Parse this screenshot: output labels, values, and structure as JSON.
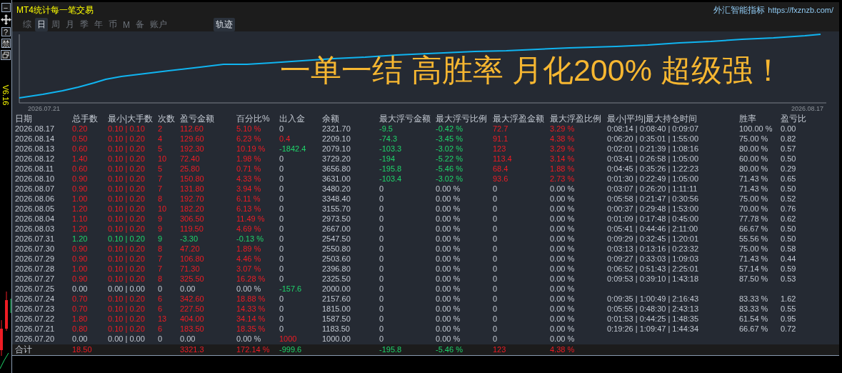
{
  "title": "MT4统计每一笔交易",
  "brand": {
    "name": "外汇智能指标",
    "url": "https://fxznzb.com/"
  },
  "side_buttons": [
    "−",
    "?",
    "禁"
  ],
  "version": "V6.16",
  "tabs": [
    {
      "label": "综",
      "selected": false
    },
    {
      "label": "日",
      "selected": true
    },
    {
      "label": "周",
      "selected": false
    },
    {
      "label": "月",
      "selected": false
    },
    {
      "label": "季",
      "selected": false
    },
    {
      "label": "年",
      "selected": false
    },
    {
      "label": "币",
      "selected": false
    },
    {
      "label": "M",
      "selected": false
    },
    {
      "label": "备",
      "selected": false
    },
    {
      "label": "账户",
      "selected": false
    },
    {
      "label": "轨迹",
      "selected": true
    }
  ],
  "chart": {
    "start_date": "2026.07.21",
    "end_date": "2026.08.17",
    "slogan": "一单一结 高胜率 月化200% 超级强！"
  },
  "table": {
    "columns": [
      "日期",
      "总手数",
      "最小|大手数",
      "次数",
      "盈亏金额",
      "百分比%",
      "出入金",
      "余额",
      "最大浮亏金额",
      "最大浮亏比例",
      "最大浮盈金额",
      "最大浮盈比例",
      "最小|平均|最大持仓时间",
      "胜率",
      "盈亏比"
    ],
    "rows": [
      {
        "cells": [
          {
            "text": "2026.08.17",
            "kind": "plain"
          },
          {
            "text": "0.20",
            "kind": "profit"
          },
          {
            "text": "0.10 | 0.10",
            "kind": "profit"
          },
          {
            "text": "2",
            "kind": "profit"
          },
          {
            "text": "112.60",
            "kind": "profit"
          },
          {
            "text": "5.10 %",
            "kind": "profit"
          },
          {
            "text": "0",
            "kind": "plain"
          },
          {
            "text": "2321.70",
            "kind": "plain"
          },
          {
            "text": "-9.5",
            "kind": "loss"
          },
          {
            "text": "-0.42 %",
            "kind": "loss"
          },
          {
            "text": "72.7",
            "kind": "profit"
          },
          {
            "text": "3.29 %",
            "kind": "profit"
          },
          {
            "text": "0:08:14 | 0:08:40 | 0:09:07",
            "kind": "plain"
          },
          {
            "text": "100.00 %",
            "kind": "plain"
          },
          {
            "text": "0.00",
            "kind": "plain"
          }
        ]
      },
      {
        "cells": [
          {
            "text": "2026.08.14",
            "kind": "plain"
          },
          {
            "text": "0.50",
            "kind": "profit"
          },
          {
            "text": "0.10 | 0.20",
            "kind": "profit"
          },
          {
            "text": "4",
            "kind": "profit"
          },
          {
            "text": "129.60",
            "kind": "profit"
          },
          {
            "text": "6.23 %",
            "kind": "profit"
          },
          {
            "text": "0.4",
            "kind": "profit"
          },
          {
            "text": "2209.10",
            "kind": "plain"
          },
          {
            "text": "-74.3",
            "kind": "loss"
          },
          {
            "text": "-3.45 %",
            "kind": "loss"
          },
          {
            "text": "91.1",
            "kind": "profit"
          },
          {
            "text": "4.38 %",
            "kind": "profit"
          },
          {
            "text": "0:06:20 | 0:35:01 | 1:55:00",
            "kind": "plain"
          },
          {
            "text": "75.00 %",
            "kind": "plain"
          },
          {
            "text": "0.82",
            "kind": "plain"
          }
        ]
      },
      {
        "cells": [
          {
            "text": "2026.08.13",
            "kind": "plain"
          },
          {
            "text": "0.60",
            "kind": "profit"
          },
          {
            "text": "0.10 | 0.20",
            "kind": "profit"
          },
          {
            "text": "5",
            "kind": "profit"
          },
          {
            "text": "192.30",
            "kind": "profit"
          },
          {
            "text": "10.19 %",
            "kind": "profit"
          },
          {
            "text": "-1842.4",
            "kind": "loss"
          },
          {
            "text": "2079.10",
            "kind": "plain"
          },
          {
            "text": "-103.3",
            "kind": "loss"
          },
          {
            "text": "-3.02 %",
            "kind": "loss"
          },
          {
            "text": "123",
            "kind": "profit"
          },
          {
            "text": "3.29 %",
            "kind": "profit"
          },
          {
            "text": "0:02:01 | 0:21:39 | 1:08:16",
            "kind": "plain"
          },
          {
            "text": "80.00 %",
            "kind": "plain"
          },
          {
            "text": "0.57",
            "kind": "plain"
          }
        ]
      },
      {
        "cells": [
          {
            "text": "2026.08.12",
            "kind": "plain"
          },
          {
            "text": "1.40",
            "kind": "profit"
          },
          {
            "text": "0.10 | 0.20",
            "kind": "profit"
          },
          {
            "text": "10",
            "kind": "profit"
          },
          {
            "text": "72.40",
            "kind": "profit"
          },
          {
            "text": "1.98 %",
            "kind": "profit"
          },
          {
            "text": "0",
            "kind": "plain"
          },
          {
            "text": "3729.20",
            "kind": "plain"
          },
          {
            "text": "-194",
            "kind": "loss"
          },
          {
            "text": "-5.22 %",
            "kind": "loss"
          },
          {
            "text": "113.4",
            "kind": "profit"
          },
          {
            "text": "3.14 %",
            "kind": "profit"
          },
          {
            "text": "0:03:41 | 0:26:58 | 1:05:00",
            "kind": "plain"
          },
          {
            "text": "60.00 %",
            "kind": "plain"
          },
          {
            "text": "0.50",
            "kind": "plain"
          }
        ]
      },
      {
        "cells": [
          {
            "text": "2026.08.11",
            "kind": "plain"
          },
          {
            "text": "0.60",
            "kind": "profit"
          },
          {
            "text": "0.10 | 0.20",
            "kind": "profit"
          },
          {
            "text": "5",
            "kind": "profit"
          },
          {
            "text": "25.80",
            "kind": "profit"
          },
          {
            "text": "0.71 %",
            "kind": "profit"
          },
          {
            "text": "0",
            "kind": "plain"
          },
          {
            "text": "3656.80",
            "kind": "plain"
          },
          {
            "text": "-195.8",
            "kind": "loss"
          },
          {
            "text": "-5.46 %",
            "kind": "loss"
          },
          {
            "text": "68.4",
            "kind": "profit"
          },
          {
            "text": "1.88 %",
            "kind": "profit"
          },
          {
            "text": "0:04:45 | 0:35:26 | 1:22:23",
            "kind": "plain"
          },
          {
            "text": "80.00 %",
            "kind": "plain"
          },
          {
            "text": "0.29",
            "kind": "plain"
          }
        ]
      },
      {
        "cells": [
          {
            "text": "2026.08.10",
            "kind": "plain"
          },
          {
            "text": "0.90",
            "kind": "profit"
          },
          {
            "text": "0.10 | 0.20",
            "kind": "profit"
          },
          {
            "text": "7",
            "kind": "profit"
          },
          {
            "text": "150.80",
            "kind": "profit"
          },
          {
            "text": "4.33 %",
            "kind": "profit"
          },
          {
            "text": "0",
            "kind": "plain"
          },
          {
            "text": "3631.00",
            "kind": "plain"
          },
          {
            "text": "-103.4",
            "kind": "loss"
          },
          {
            "text": "-3.02 %",
            "kind": "loss"
          },
          {
            "text": "93.6",
            "kind": "profit"
          },
          {
            "text": "2.73 %",
            "kind": "profit"
          },
          {
            "text": "0:01:30 | 0:22:49 | 1:05:00",
            "kind": "plain"
          },
          {
            "text": "71.43 %",
            "kind": "plain"
          },
          {
            "text": "0.65",
            "kind": "plain"
          }
        ]
      },
      {
        "cells": [
          {
            "text": "2026.08.07",
            "kind": "plain"
          },
          {
            "text": "0.90",
            "kind": "profit"
          },
          {
            "text": "0.10 | 0.20",
            "kind": "profit"
          },
          {
            "text": "7",
            "kind": "profit"
          },
          {
            "text": "131.80",
            "kind": "profit"
          },
          {
            "text": "3.94 %",
            "kind": "profit"
          },
          {
            "text": "0",
            "kind": "plain"
          },
          {
            "text": "3480.20",
            "kind": "plain"
          },
          {
            "text": "0",
            "kind": "plain"
          },
          {
            "text": "0.00 %",
            "kind": "plain"
          },
          {
            "text": "0",
            "kind": "plain"
          },
          {
            "text": "0.00 %",
            "kind": "plain"
          },
          {
            "text": "0:03:07 | 0:26:20 | 1:11:11",
            "kind": "plain"
          },
          {
            "text": "71.43 %",
            "kind": "plain"
          },
          {
            "text": "0.50",
            "kind": "plain"
          }
        ]
      },
      {
        "cells": [
          {
            "text": "2026.08.06",
            "kind": "plain"
          },
          {
            "text": "1.00",
            "kind": "profit"
          },
          {
            "text": "0.10 | 0.20",
            "kind": "profit"
          },
          {
            "text": "8",
            "kind": "profit"
          },
          {
            "text": "192.70",
            "kind": "profit"
          },
          {
            "text": "6.11 %",
            "kind": "profit"
          },
          {
            "text": "0",
            "kind": "plain"
          },
          {
            "text": "3348.40",
            "kind": "plain"
          },
          {
            "text": "0",
            "kind": "plain"
          },
          {
            "text": "0.00 %",
            "kind": "plain"
          },
          {
            "text": "0",
            "kind": "plain"
          },
          {
            "text": "0.00 %",
            "kind": "plain"
          },
          {
            "text": "0:05:58 | 0:21:47 | 0:30:56",
            "kind": "plain"
          },
          {
            "text": "75.00 %",
            "kind": "plain"
          },
          {
            "text": "0.52",
            "kind": "plain"
          }
        ]
      },
      {
        "cells": [
          {
            "text": "2026.08.05",
            "kind": "plain"
          },
          {
            "text": "1.20",
            "kind": "profit"
          },
          {
            "text": "0.10 | 0.20",
            "kind": "profit"
          },
          {
            "text": "10",
            "kind": "profit"
          },
          {
            "text": "182.20",
            "kind": "profit"
          },
          {
            "text": "6.13 %",
            "kind": "profit"
          },
          {
            "text": "0",
            "kind": "plain"
          },
          {
            "text": "3155.70",
            "kind": "plain"
          },
          {
            "text": "0",
            "kind": "plain"
          },
          {
            "text": "0.00 %",
            "kind": "plain"
          },
          {
            "text": "0",
            "kind": "plain"
          },
          {
            "text": "0.00 %",
            "kind": "plain"
          },
          {
            "text": "0:00:37 | 0:29:48 | 1:53:00",
            "kind": "plain"
          },
          {
            "text": "70.00 %",
            "kind": "plain"
          },
          {
            "text": "0.76",
            "kind": "plain"
          }
        ]
      },
      {
        "cells": [
          {
            "text": "2026.08.04",
            "kind": "plain"
          },
          {
            "text": "1.10",
            "kind": "profit"
          },
          {
            "text": "0.10 | 0.20",
            "kind": "profit"
          },
          {
            "text": "9",
            "kind": "profit"
          },
          {
            "text": "306.50",
            "kind": "profit"
          },
          {
            "text": "11.49 %",
            "kind": "profit"
          },
          {
            "text": "0",
            "kind": "plain"
          },
          {
            "text": "2973.50",
            "kind": "plain"
          },
          {
            "text": "0",
            "kind": "plain"
          },
          {
            "text": "0.00 %",
            "kind": "plain"
          },
          {
            "text": "0",
            "kind": "plain"
          },
          {
            "text": "0.00 %",
            "kind": "plain"
          },
          {
            "text": "0:01:09 | 0:17:48 | 0:45:00",
            "kind": "plain"
          },
          {
            "text": "77.78 %",
            "kind": "plain"
          },
          {
            "text": "0.62",
            "kind": "plain"
          }
        ]
      },
      {
        "cells": [
          {
            "text": "2026.08.03",
            "kind": "plain"
          },
          {
            "text": "1.20",
            "kind": "profit"
          },
          {
            "text": "0.10 | 0.20",
            "kind": "profit"
          },
          {
            "text": "9",
            "kind": "profit"
          },
          {
            "text": "119.50",
            "kind": "profit"
          },
          {
            "text": "4.69 %",
            "kind": "profit"
          },
          {
            "text": "0",
            "kind": "plain"
          },
          {
            "text": "2667.00",
            "kind": "plain"
          },
          {
            "text": "0",
            "kind": "plain"
          },
          {
            "text": "0.00 %",
            "kind": "plain"
          },
          {
            "text": "0",
            "kind": "plain"
          },
          {
            "text": "0.00 %",
            "kind": "plain"
          },
          {
            "text": "0:05:41 | 0:44:46 | 2:11:00",
            "kind": "plain"
          },
          {
            "text": "66.67 %",
            "kind": "plain"
          },
          {
            "text": "0.50",
            "kind": "plain"
          }
        ]
      },
      {
        "cells": [
          {
            "text": "2026.07.31",
            "kind": "plain"
          },
          {
            "text": "1.20",
            "kind": "loss"
          },
          {
            "text": "0.10 | 0.20",
            "kind": "loss"
          },
          {
            "text": "9",
            "kind": "loss"
          },
          {
            "text": "-3.30",
            "kind": "loss"
          },
          {
            "text": "-0.13 %",
            "kind": "loss"
          },
          {
            "text": "0",
            "kind": "plain"
          },
          {
            "text": "2547.50",
            "kind": "plain"
          },
          {
            "text": "0",
            "kind": "plain"
          },
          {
            "text": "0.00 %",
            "kind": "plain"
          },
          {
            "text": "0",
            "kind": "plain"
          },
          {
            "text": "0.00 %",
            "kind": "plain"
          },
          {
            "text": "0:09:29 | 0:32:45 | 1:20:01",
            "kind": "plain"
          },
          {
            "text": "55.56 %",
            "kind": "plain"
          },
          {
            "text": "0.50",
            "kind": "plain"
          }
        ]
      },
      {
        "cells": [
          {
            "text": "2026.07.30",
            "kind": "plain"
          },
          {
            "text": "0.90",
            "kind": "profit"
          },
          {
            "text": "0.10 | 0.20",
            "kind": "profit"
          },
          {
            "text": "8",
            "kind": "profit"
          },
          {
            "text": "47.20",
            "kind": "profit"
          },
          {
            "text": "1.89 %",
            "kind": "profit"
          },
          {
            "text": "0",
            "kind": "plain"
          },
          {
            "text": "2550.80",
            "kind": "plain"
          },
          {
            "text": "0",
            "kind": "plain"
          },
          {
            "text": "0.00 %",
            "kind": "plain"
          },
          {
            "text": "0",
            "kind": "plain"
          },
          {
            "text": "0.00 %",
            "kind": "plain"
          },
          {
            "text": "0:03:13 | 0:13:16 | 0:23:32",
            "kind": "plain"
          },
          {
            "text": "75.00 %",
            "kind": "plain"
          },
          {
            "text": "0.58",
            "kind": "plain"
          }
        ]
      },
      {
        "cells": [
          {
            "text": "2026.07.29",
            "kind": "plain"
          },
          {
            "text": "0.90",
            "kind": "profit"
          },
          {
            "text": "0.10 | 0.20",
            "kind": "profit"
          },
          {
            "text": "7",
            "kind": "profit"
          },
          {
            "text": "106.80",
            "kind": "profit"
          },
          {
            "text": "4.46 %",
            "kind": "profit"
          },
          {
            "text": "0",
            "kind": "plain"
          },
          {
            "text": "2503.60",
            "kind": "plain"
          },
          {
            "text": "0",
            "kind": "plain"
          },
          {
            "text": "0.00 %",
            "kind": "plain"
          },
          {
            "text": "0",
            "kind": "plain"
          },
          {
            "text": "0.00 %",
            "kind": "plain"
          },
          {
            "text": "0:09:27 | 0:33:03 | 1:09:03",
            "kind": "plain"
          },
          {
            "text": "71.43 %",
            "kind": "plain"
          },
          {
            "text": "0.44",
            "kind": "plain"
          }
        ]
      },
      {
        "cells": [
          {
            "text": "2026.07.28",
            "kind": "plain"
          },
          {
            "text": "1.00",
            "kind": "profit"
          },
          {
            "text": "0.10 | 0.20",
            "kind": "profit"
          },
          {
            "text": "7",
            "kind": "profit"
          },
          {
            "text": "71.30",
            "kind": "profit"
          },
          {
            "text": "3.07 %",
            "kind": "profit"
          },
          {
            "text": "0",
            "kind": "plain"
          },
          {
            "text": "2396.80",
            "kind": "plain"
          },
          {
            "text": "0",
            "kind": "plain"
          },
          {
            "text": "0.00 %",
            "kind": "plain"
          },
          {
            "text": "0",
            "kind": "plain"
          },
          {
            "text": "0.00 %",
            "kind": "plain"
          },
          {
            "text": "0:06:52 | 0:51:43 | 2:25:01",
            "kind": "plain"
          },
          {
            "text": "57.14 %",
            "kind": "plain"
          },
          {
            "text": "0.59",
            "kind": "plain"
          }
        ]
      },
      {
        "cells": [
          {
            "text": "2026.07.27",
            "kind": "plain"
          },
          {
            "text": "0.90",
            "kind": "profit"
          },
          {
            "text": "0.10 | 0.20",
            "kind": "profit"
          },
          {
            "text": "8",
            "kind": "profit"
          },
          {
            "text": "325.50",
            "kind": "profit"
          },
          {
            "text": "16.28 %",
            "kind": "profit"
          },
          {
            "text": "0",
            "kind": "plain"
          },
          {
            "text": "2325.50",
            "kind": "plain"
          },
          {
            "text": "0",
            "kind": "plain"
          },
          {
            "text": "0.00 %",
            "kind": "plain"
          },
          {
            "text": "0",
            "kind": "plain"
          },
          {
            "text": "0.00 %",
            "kind": "plain"
          },
          {
            "text": "0:09:53 | 0:39:10 | 1:43:18",
            "kind": "plain"
          },
          {
            "text": "87.50 %",
            "kind": "plain"
          },
          {
            "text": "0.53",
            "kind": "plain"
          }
        ]
      },
      {
        "cells": [
          {
            "text": "2026.07.25",
            "kind": "plain"
          },
          {
            "text": "0.00",
            "kind": "plain"
          },
          {
            "text": "0.00 | 0.00",
            "kind": "plain"
          },
          {
            "text": "0",
            "kind": "plain"
          },
          {
            "text": "0.00",
            "kind": "plain"
          },
          {
            "text": "0.00 %",
            "kind": "plain"
          },
          {
            "text": "-157.6",
            "kind": "loss"
          },
          {
            "text": "2000.00",
            "kind": "plain"
          },
          {
            "text": "0",
            "kind": "plain"
          },
          {
            "text": "0.00 %",
            "kind": "plain"
          },
          {
            "text": "0",
            "kind": "plain"
          },
          {
            "text": "0.00 %",
            "kind": "plain"
          },
          null,
          null,
          null
        ]
      },
      {
        "cells": [
          {
            "text": "2026.07.24",
            "kind": "plain"
          },
          {
            "text": "0.70",
            "kind": "profit"
          },
          {
            "text": "0.10 | 0.20",
            "kind": "profit"
          },
          {
            "text": "6",
            "kind": "profit"
          },
          {
            "text": "342.60",
            "kind": "profit"
          },
          {
            "text": "18.88 %",
            "kind": "profit"
          },
          {
            "text": "0",
            "kind": "plain"
          },
          {
            "text": "2157.60",
            "kind": "plain"
          },
          {
            "text": "0",
            "kind": "plain"
          },
          {
            "text": "0.00 %",
            "kind": "plain"
          },
          {
            "text": "0",
            "kind": "plain"
          },
          {
            "text": "0.00 %",
            "kind": "plain"
          },
          {
            "text": "0:09:35 | 1:00:49 | 2:16:43",
            "kind": "plain"
          },
          {
            "text": "83.33 %",
            "kind": "plain"
          },
          {
            "text": "1.62",
            "kind": "plain"
          }
        ]
      },
      {
        "cells": [
          {
            "text": "2026.07.23",
            "kind": "plain"
          },
          {
            "text": "0.70",
            "kind": "profit"
          },
          {
            "text": "0.10 | 0.20",
            "kind": "profit"
          },
          {
            "text": "6",
            "kind": "profit"
          },
          {
            "text": "227.50",
            "kind": "profit"
          },
          {
            "text": "14.33 %",
            "kind": "profit"
          },
          {
            "text": "0",
            "kind": "plain"
          },
          {
            "text": "1815.00",
            "kind": "plain"
          },
          {
            "text": "0",
            "kind": "plain"
          },
          {
            "text": "0.00 %",
            "kind": "plain"
          },
          {
            "text": "0",
            "kind": "plain"
          },
          {
            "text": "0.00 %",
            "kind": "plain"
          },
          {
            "text": "0:05:55 | 0:48:30 | 2:43:13",
            "kind": "plain"
          },
          {
            "text": "83.33 %",
            "kind": "plain"
          },
          {
            "text": "0.55",
            "kind": "plain"
          }
        ]
      },
      {
        "cells": [
          {
            "text": "2026.07.22",
            "kind": "plain"
          },
          {
            "text": "1.80",
            "kind": "profit"
          },
          {
            "text": "0.10 | 0.20",
            "kind": "profit"
          },
          {
            "text": "13",
            "kind": "profit"
          },
          {
            "text": "404.00",
            "kind": "profit"
          },
          {
            "text": "34.14 %",
            "kind": "profit"
          },
          {
            "text": "0",
            "kind": "plain"
          },
          {
            "text": "1587.50",
            "kind": "plain"
          },
          {
            "text": "0",
            "kind": "plain"
          },
          {
            "text": "0.00 %",
            "kind": "plain"
          },
          {
            "text": "0",
            "kind": "plain"
          },
          {
            "text": "0.00 %",
            "kind": "plain"
          },
          {
            "text": "0:01:53 | 0:44:25 | 1:48:35",
            "kind": "plain"
          },
          {
            "text": "61.54 %",
            "kind": "plain"
          },
          {
            "text": "0.95",
            "kind": "plain"
          }
        ]
      },
      {
        "cells": [
          {
            "text": "2026.07.21",
            "kind": "plain"
          },
          {
            "text": "0.80",
            "kind": "profit"
          },
          {
            "text": "0.10 | 0.20",
            "kind": "profit"
          },
          {
            "text": "6",
            "kind": "profit"
          },
          {
            "text": "183.50",
            "kind": "profit"
          },
          {
            "text": "18.35 %",
            "kind": "profit"
          },
          {
            "text": "0",
            "kind": "plain"
          },
          {
            "text": "1183.50",
            "kind": "plain"
          },
          {
            "text": "0",
            "kind": "plain"
          },
          {
            "text": "0.00 %",
            "kind": "plain"
          },
          {
            "text": "0",
            "kind": "plain"
          },
          {
            "text": "0.00 %",
            "kind": "plain"
          },
          {
            "text": "0:19:26 | 1:09:47 | 1:44:34",
            "kind": "plain"
          },
          {
            "text": "66.67 %",
            "kind": "plain"
          },
          {
            "text": "0.72",
            "kind": "plain"
          }
        ]
      },
      {
        "cells": [
          {
            "text": "2026.07.20",
            "kind": "plain"
          },
          {
            "text": "0.00",
            "kind": "plain"
          },
          {
            "text": "0.00 | 0.00",
            "kind": "plain"
          },
          {
            "text": "0",
            "kind": "plain"
          },
          {
            "text": "0.00",
            "kind": "plain"
          },
          {
            "text": "0.00 %",
            "kind": "plain"
          },
          {
            "text": "1000",
            "kind": "profit"
          },
          {
            "text": "1000.00",
            "kind": "plain"
          },
          {
            "text": "0",
            "kind": "plain"
          },
          {
            "text": "0.00 %",
            "kind": "plain"
          },
          {
            "text": "0",
            "kind": "plain"
          },
          {
            "text": "0.00 %",
            "kind": "plain"
          },
          null,
          null,
          null
        ]
      }
    ],
    "total": {
      "cells": [
        {
          "text": "合计",
          "kind": "plain"
        },
        {
          "text": "18.50",
          "kind": "profit"
        },
        null,
        null,
        {
          "text": "3321.3",
          "kind": "profit"
        },
        {
          "text": "172.14 %",
          "kind": "profit"
        },
        {
          "text": "-999.6",
          "kind": "loss"
        },
        null,
        {
          "text": "-195.8",
          "kind": "loss"
        },
        {
          "text": "-5.46 %",
          "kind": "loss"
        },
        {
          "text": "123",
          "kind": "profit"
        },
        {
          "text": "4.38 %",
          "kind": "profit"
        },
        null,
        null,
        null
      ]
    }
  }
}
